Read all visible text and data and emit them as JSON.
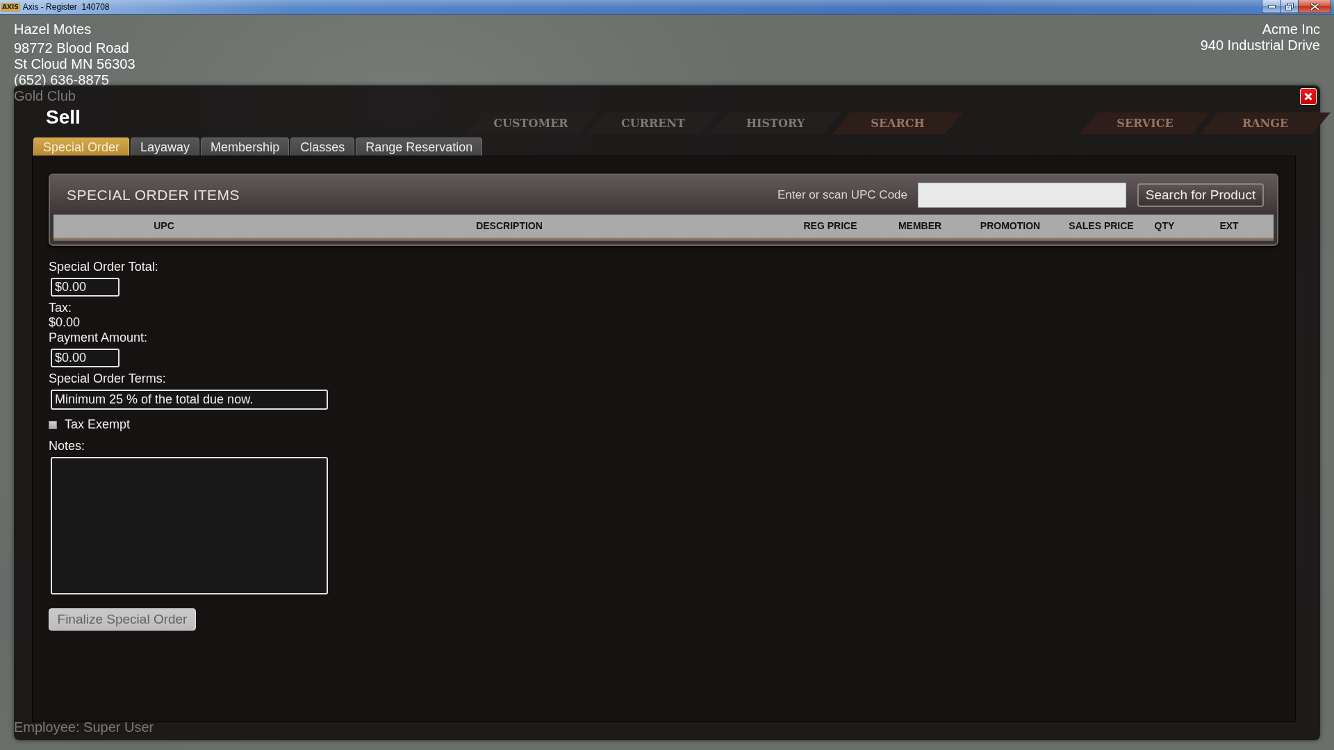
{
  "window": {
    "title": "Axis - Register  140708",
    "icon_text": "AXIS"
  },
  "customer": {
    "name": "Hazel Motes",
    "address_lines": [
      "98772 Blood Road",
      "St Cloud MN 56303"
    ],
    "phone": "(652) 636-8875",
    "club": "Gold Club"
  },
  "store": {
    "name": "Acme Inc",
    "address": "940 Industrial Drive"
  },
  "nav": {
    "main_tabs": [
      {
        "label": "CUSTOMER",
        "kind": "plain"
      },
      {
        "label": "CURRENT",
        "kind": "plain"
      },
      {
        "label": "HISTORY",
        "kind": "plain"
      },
      {
        "label": "SEARCH",
        "kind": "accent"
      }
    ],
    "side_tabs": [
      {
        "label": "SERVICE",
        "kind": "accent"
      },
      {
        "label": "RANGE",
        "kind": "accent"
      }
    ]
  },
  "status_bar": {
    "employee": "Employee: Super User"
  },
  "dialog": {
    "title": "Sell",
    "tabs": [
      {
        "label": "Special Order",
        "selected": true
      },
      {
        "label": "Layaway",
        "selected": false
      },
      {
        "label": "Membership",
        "selected": false
      },
      {
        "label": "Classes",
        "selected": false
      },
      {
        "label": "Range Reservation",
        "selected": false
      }
    ],
    "items_panel": {
      "title": "SPECIAL ORDER ITEMS",
      "upc_label": "Enter or scan UPC Code",
      "search_button": "Search for Product",
      "columns": [
        "UPC",
        "DESCRIPTION",
        "REG PRICE",
        "MEMBER",
        "PROMOTION",
        "SALES PRICE",
        "QTY",
        "EXT"
      ]
    },
    "form": [
      {
        "kind": "input",
        "label": "Special Order Total:",
        "value": "$0.00"
      },
      {
        "kind": "readout",
        "label": "Tax:",
        "value": "$0.00"
      },
      {
        "kind": "input",
        "label": "Payment Amount:",
        "value": "$0.00"
      },
      {
        "kind": "wide_input",
        "label": "Special Order Terms:",
        "value": "Minimum 25 % of the total due now."
      },
      {
        "kind": "checkbox",
        "label": "Tax Exempt",
        "checked": false
      },
      {
        "kind": "textarea",
        "label": "Notes:"
      }
    ],
    "finalize_button": {
      "label": "Finalize Special Order",
      "disabled": true
    }
  }
}
